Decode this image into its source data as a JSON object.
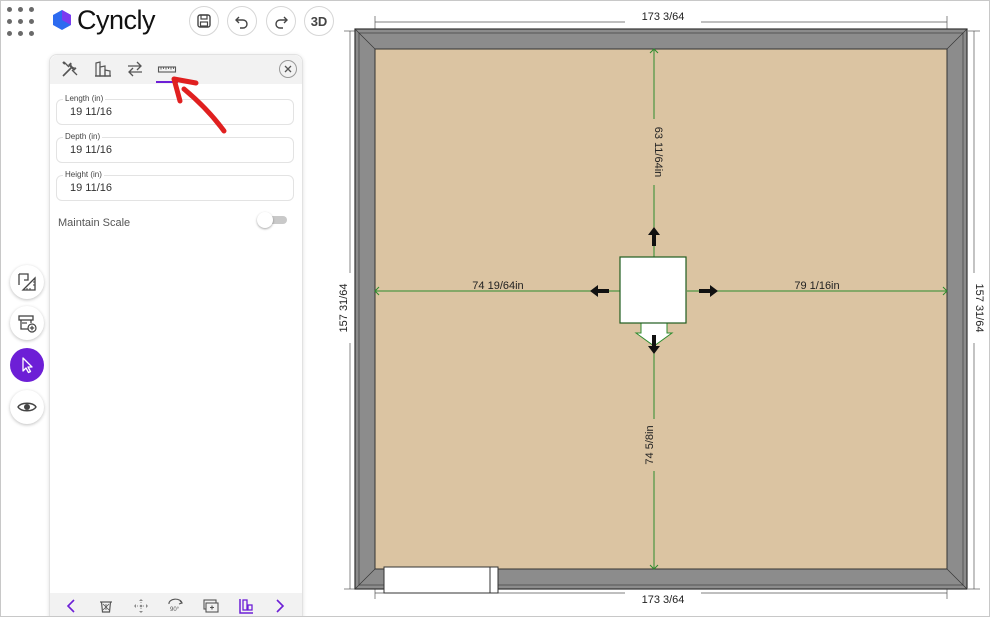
{
  "brand": {
    "name": "Cyncly",
    "primary_color": "#6d1fd6",
    "mark_color_a": "#2d6bf0",
    "mark_color_b": "#7b3cf0"
  },
  "toolbar": {
    "save_icon": "save-icon",
    "undo_icon": "undo-icon",
    "redo_icon": "redo-icon",
    "view3d_label": "3D"
  },
  "rail": {
    "items": [
      "floorplan-measure-icon",
      "add-cabinet-icon",
      "select-pointer-icon",
      "view-eye-icon"
    ],
    "active": "select-pointer-icon"
  },
  "panel": {
    "tabs": [
      "tools-icon",
      "material-icon",
      "swap-icon",
      "ruler-icon"
    ],
    "active_tab": "ruler-icon",
    "fields": [
      {
        "label": "Length (in)",
        "value": "19 11/16"
      },
      {
        "label": "Depth (in)",
        "value": "19 11/16"
      },
      {
        "label": "Height (in)",
        "value": "19 11/16"
      }
    ],
    "maintain_scale": {
      "label": "Maintain Scale",
      "on": false
    },
    "footer": [
      "prev-chevron-icon",
      "delete-icon",
      "move-icon",
      "rotate-icon",
      "duplicate-icon",
      "align-icon",
      "next-chevron-icon"
    ]
  },
  "annotation": {
    "color": "#e02020"
  },
  "plan": {
    "floor_color": "#dbc4a2",
    "wall_color": "#8c8c8c",
    "measure_line_color": "#2e8b2e",
    "dims": {
      "top": "173 3/64",
      "bottom": "173 3/64",
      "left": "157 31/64",
      "right": "157 31/64"
    },
    "measures": {
      "up": "63 11/64in",
      "left": "74 19/64in",
      "right": "79 1/16in",
      "down": "74 5/8in"
    }
  }
}
